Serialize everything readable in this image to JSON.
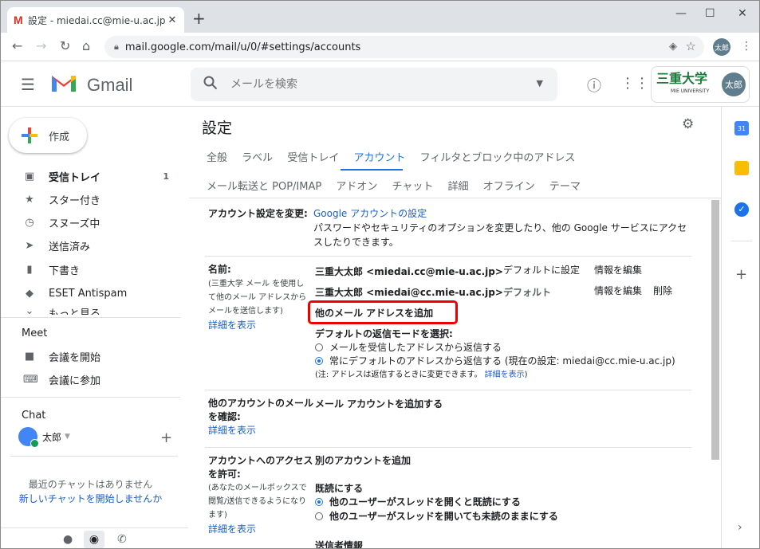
{
  "browser": {
    "tab_title": "設定 - miedai.cc@mie-u.ac.jp - 三",
    "tab_close": "✕",
    "new_tab": "+",
    "url": "mail.google.com/mail/u/0/#settings/accounts",
    "profile_initials": "太郎",
    "win_min": "—",
    "win_max": "☐",
    "win_close": "✕"
  },
  "header": {
    "app_name": "Gmail",
    "search_placeholder": "メールを検索",
    "org_name": "三重大学",
    "org_sub": "MIE UNIVERSITY",
    "avatar_initials": "太郎"
  },
  "sidebar": {
    "compose_label": "作成",
    "items": [
      {
        "label": "受信トレイ",
        "count": "1",
        "icon": "inbox-icon"
      },
      {
        "label": "スター付き",
        "icon": "star-icon"
      },
      {
        "label": "スヌーズ中",
        "icon": "clock-icon"
      },
      {
        "label": "送信済み",
        "icon": "send-icon"
      },
      {
        "label": "下書き",
        "icon": "draft-icon"
      },
      {
        "label": "ESET Antispam",
        "icon": "label-icon"
      },
      {
        "label": "もっと見る",
        "icon": "chevron-down-icon"
      }
    ],
    "meet_title": "Meet",
    "meet_items": [
      {
        "label": "会議を開始",
        "icon": "video-icon"
      },
      {
        "label": "会議に参加",
        "icon": "keyboard-icon"
      }
    ],
    "chat_title": "Chat",
    "chat_user": "太郎",
    "no_chats": "最近のチャットはありません",
    "start_chat": "新しいチャットを開始しませんか"
  },
  "settings": {
    "title": "設定",
    "tabs_row1": [
      "全般",
      "ラベル",
      "受信トレイ",
      "アカウント",
      "フィルタとブロック中のアドレス"
    ],
    "active_tab": "アカウント",
    "tabs_row2": [
      "メール転送と POP/IMAP",
      "アドオン",
      "チャット",
      "詳細",
      "オフライン",
      "テーマ"
    ],
    "account_settings": {
      "label": "アカウント設定を変更:",
      "link": "Google アカウントの設定",
      "desc": "パスワードやセキュリティのオプションを変更したり、他の Google サービスにアクセスしたりできます。"
    },
    "name_section": {
      "label": "名前:",
      "sub": "(三重大学 メール を使用して他のメール アドレスからメールを送信します)",
      "more": "詳細を表示",
      "addr1": "三重大太郎 <miedai.cc@mie-u.ac.jp>",
      "addr1_default_link": "デフォルトに設定",
      "addr1_edit": "情報を編集",
      "addr2": "三重大太郎 <miedai@cc.mie-u.ac.jp>",
      "addr2_default": "デフォルト",
      "addr2_edit": "情報を編集",
      "addr2_delete": "削除",
      "add_other": "他のメール アドレスを追加",
      "reply_mode_title": "デフォルトの返信モードを選択:",
      "reply_opt1": "メールを受信したアドレスから返信する",
      "reply_opt2": "常にデフォルトのアドレスから返信する (現在の設定: miedai@cc.mie-u.ac.jp)",
      "note": "(注: アドレスは返信するときに変更できます。",
      "note_link": "詳細を表示",
      "note_end": ")"
    },
    "check_mail": {
      "label": "他のアカウントのメールを確認:",
      "more": "詳細を表示",
      "link": "メール アカウントを追加する"
    },
    "grant_access": {
      "label": "アカウントへのアクセスを許可:",
      "sub": "(あなたのメールボックスで閲覧/送信できるようになります)",
      "more": "詳細を表示",
      "link": "別のアカウントを追加",
      "read_title": "既読にする",
      "read_opt1": "他のユーザーがスレッドを開くと既読にする",
      "read_opt2": "他のユーザーがスレッドを開いても未読のままにする",
      "sender_info": "送信者情報"
    }
  },
  "colors": {
    "accent": "#1a73e8",
    "link": "#1a5fc8",
    "highlight": "#ee0000"
  }
}
